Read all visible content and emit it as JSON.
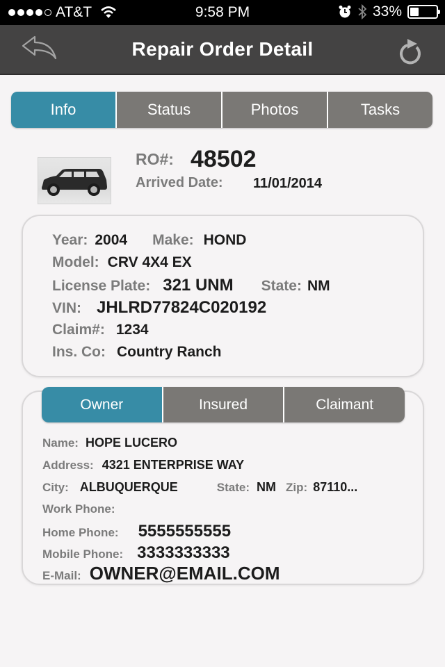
{
  "status_bar": {
    "carrier": "AT&T",
    "signal_bars_filled": 4,
    "signal_bars_total": 5,
    "time": "9:58 PM",
    "battery_percent_label": "33%",
    "battery_level": 0.33,
    "icons": [
      "wifi-icon",
      "alarm-icon",
      "bluetooth-icon",
      "battery-icon"
    ]
  },
  "nav": {
    "title": "Repair Order Detail",
    "back_icon": "reply-arrow-icon",
    "refresh_icon": "refresh-icon"
  },
  "main_tabs": [
    {
      "label": "Info",
      "active": true
    },
    {
      "label": "Status",
      "active": false
    },
    {
      "label": "Photos",
      "active": false
    },
    {
      "label": "Tasks",
      "active": false
    }
  ],
  "colors": {
    "active_tab": "#378ca6",
    "inactive_tab": "#7a7875",
    "nav_bar": "#444343",
    "label": "#7b7b7b",
    "value": "#1c1c1c"
  },
  "header": {
    "ro_label": "RO#:",
    "ro_value": "48502",
    "arrived_label": "Arrived Date:",
    "arrived_value": "11/01/2014",
    "vehicle_image": "suv-car-icon"
  },
  "vehicle": {
    "year_label": "Year:",
    "year": "2004",
    "make_label": "Make:",
    "make": "HOND",
    "model_label": "Model:",
    "model": "CRV 4X4 EX",
    "plate_label": "License Plate:",
    "plate": "321 UNM",
    "state_label": "State:",
    "state": "NM",
    "vin_label": "VIN:",
    "vin": "JHLRD77824C020192",
    "claim_label": "Claim#:",
    "claim": "1234",
    "insco_label": "Ins. Co:",
    "insco": "Country Ranch"
  },
  "contact_tabs": [
    {
      "label": "Owner",
      "active": true
    },
    {
      "label": "Insured",
      "active": false
    },
    {
      "label": "Claimant",
      "active": false
    }
  ],
  "contact": {
    "name_label": "Name:",
    "name": "HOPE LUCERO",
    "address_label": "Address:",
    "address": "4321 ENTERPRISE WAY",
    "city_label": "City:",
    "city": "ALBUQUERQUE",
    "state_label": "State:",
    "state": "NM",
    "zip_label": "Zip:",
    "zip": "87110...",
    "work_phone_label": "Work Phone:",
    "work_phone": "",
    "home_phone_label": "Home Phone:",
    "home_phone": "5555555555",
    "mobile_phone_label": "Mobile Phone:",
    "mobile_phone": "3333333333",
    "email_label": "E-Mail:",
    "email": "OWNER@EMAIL.COM"
  }
}
